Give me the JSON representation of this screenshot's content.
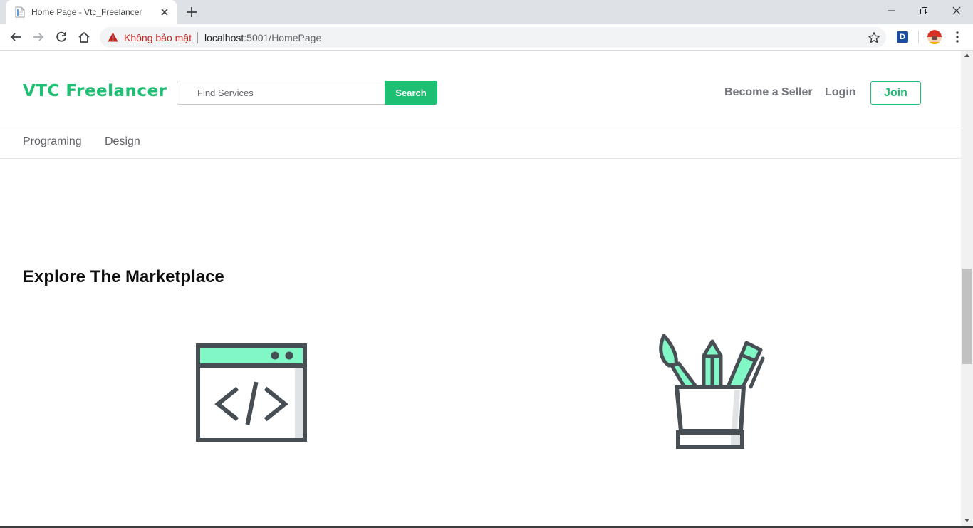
{
  "browser": {
    "tab": {
      "title": "Home Page - Vtc_Freelancer"
    },
    "security_label": "Không bảo mật",
    "url": {
      "host": "localhost",
      "rest": ":5001/HomePage"
    },
    "extension_label": "D"
  },
  "site": {
    "brand": {
      "name": "VTC Freelancer",
      "color": "#1dbf73"
    },
    "search": {
      "placeholder": "Find Services",
      "value": "",
      "button_label": "Search"
    },
    "header_nav": {
      "become_seller": "Become a Seller",
      "login": "Login",
      "join": "Join"
    },
    "categories": [
      "Programing",
      "Design"
    ],
    "marketplace": {
      "title": "Explore The Marketplace",
      "items": [
        {
          "icon": "code-window-icon"
        },
        {
          "icon": "design-tools-icon"
        }
      ]
    }
  }
}
